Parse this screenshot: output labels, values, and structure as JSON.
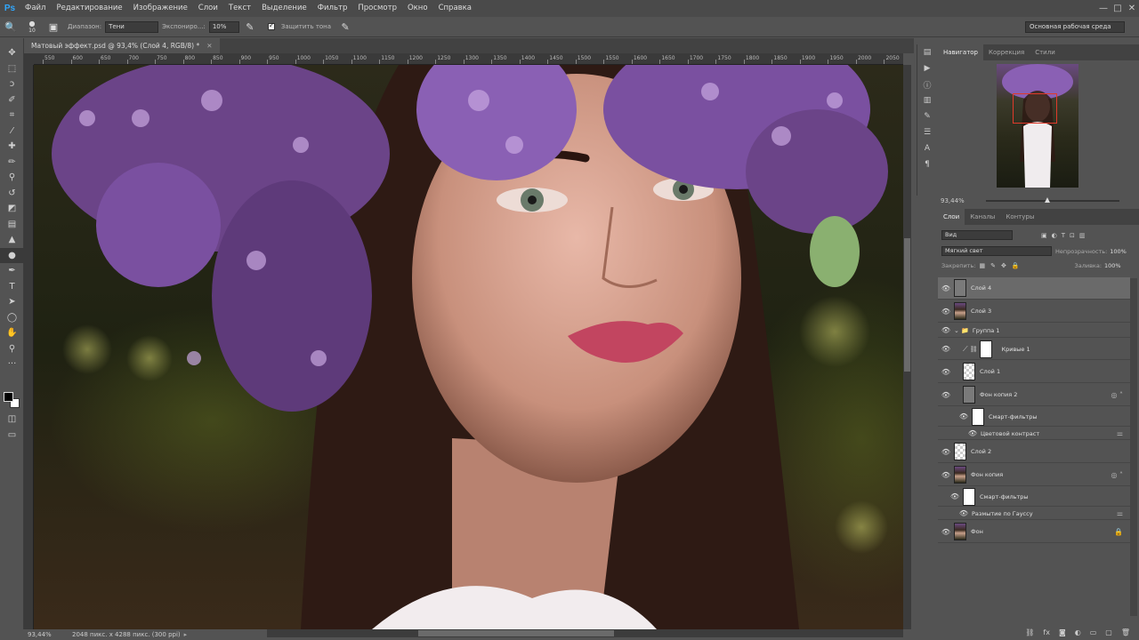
{
  "app": {
    "logo": "Ps"
  },
  "menu": [
    "Файл",
    "Редактирование",
    "Изображение",
    "Слои",
    "Текст",
    "Выделение",
    "Фильтр",
    "Просмотр",
    "Окно",
    "Справка"
  ],
  "window_controls": [
    "—",
    "□",
    "✕"
  ],
  "options": {
    "brush_size": "10",
    "range_label": "Диапазон:",
    "range_value": "Тени",
    "exposure_label": "Экспониро...:",
    "exposure_value": "10%",
    "protect_tones": "Защитить тона",
    "workspace": "Основная рабочая среда"
  },
  "document": {
    "tab_title": "Матовый эффект.psd @ 93,4% (Слой 4, RGB/8) *",
    "close": "✕"
  },
  "ruler_ticks": [
    "550",
    "600",
    "650",
    "700",
    "750",
    "800",
    "850",
    "900",
    "950",
    "1000",
    "1050",
    "1100",
    "1150",
    "1200",
    "1250",
    "1300",
    "1350",
    "1400",
    "1450",
    "1500",
    "1550",
    "1600",
    "1650",
    "1700",
    "1750",
    "1800",
    "1850",
    "1900",
    "1950",
    "2000",
    "2050"
  ],
  "status": {
    "zoom": "93,44%",
    "info": "2048 пикс. x 4288 пикс. (300 ppi)",
    "arrow": "▸"
  },
  "navigator": {
    "tabs": [
      "Навигатор",
      "Коррекция",
      "Стили"
    ],
    "zoom": "93,44%",
    "zoom_level": 0.46
  },
  "layers": {
    "tabs": [
      "Слои",
      "Каналы",
      "Контуры"
    ],
    "filter_label": "Вид",
    "blend_mode": "Мягкий свет",
    "opacity_label": "Непрозрачность:",
    "opacity_value": "100%",
    "lock_label": "Закрепить:",
    "fill_label": "Заливка:",
    "fill_value": "100%",
    "items": [
      {
        "name": "Слой 4"
      },
      {
        "name": "Слой 3"
      },
      {
        "name": "Группа 1"
      },
      {
        "name": "Кривые 1"
      },
      {
        "name": "Слой 1"
      },
      {
        "name": "Фон копия 2"
      },
      {
        "name": "Смарт-фильтры"
      },
      {
        "name": "Цветовой контраст"
      },
      {
        "name": "Слой 2"
      },
      {
        "name": "Фон копия"
      },
      {
        "name": "Смарт-фильтры"
      },
      {
        "name": "Размытие по Гауссу"
      },
      {
        "name": "Фон"
      }
    ]
  },
  "colors": {
    "accent": "#31a8ff",
    "panel": "#535353",
    "selected_layer": "#6a6a6a",
    "nav_box": "#e03a2a"
  }
}
